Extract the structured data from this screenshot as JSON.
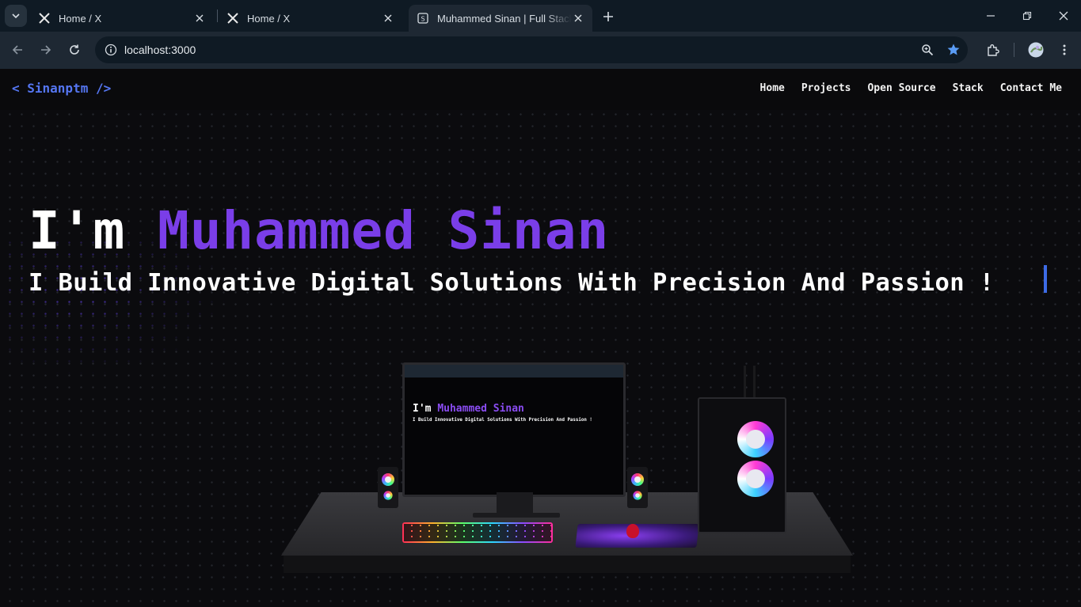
{
  "browser": {
    "tabs": [
      {
        "title": "Home / X",
        "icon": "x-logo-icon",
        "active": false
      },
      {
        "title": "Home / X",
        "icon": "x-logo-icon",
        "active": false
      },
      {
        "title": "Muhammed Sinan | Full Stack Developer",
        "icon": "site-favicon-icon",
        "active": true
      }
    ],
    "url": "localhost:3000",
    "bookmarked": true,
    "accent_color": "#5a9cf5"
  },
  "site": {
    "logo": "< Sinanptm />",
    "nav": [
      "Home",
      "Projects",
      "Open Source",
      "Stack",
      "Contact Me"
    ],
    "hero": {
      "prefix": "I'm ",
      "name": "Muhammed Sinan",
      "subtitle": "I Build Innovative Digital Solutions With Precision And Passion !"
    },
    "colors": {
      "logo": "#5576f2",
      "name": "#7a3ee8",
      "caret": "#3d6be6",
      "background": "#0b0b0e"
    },
    "scene": {
      "monitor": {
        "title_prefix": "I'm ",
        "title_name": "Muhammed Sinan",
        "subtitle": "I Build Innovative Digital Solutions With Precision And Passion !"
      }
    }
  }
}
